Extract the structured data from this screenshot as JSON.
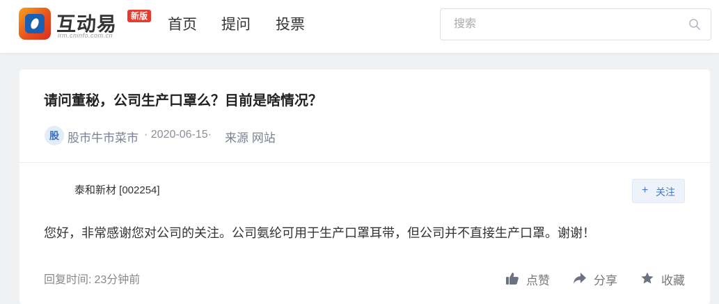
{
  "header": {
    "logo": {
      "name": "互动易",
      "domain": "irm.cninfo.com.cn",
      "badge": "新版"
    },
    "nav": [
      "首页",
      "提问",
      "投票"
    ],
    "search": {
      "placeholder": "搜索",
      "value": ""
    }
  },
  "question": {
    "title": "请问董秘，公司生产口罩么？目前是啥情况？",
    "avatar_char": "股",
    "author": "股市牛市菜市",
    "date": "· 2020-06-15·",
    "source": "来源 网站"
  },
  "answer": {
    "company": "泰和新材 [002254]",
    "follow_label": "关注",
    "text": "您好，非常感谢您对公司的关注。公司氨纶可用于生产口罩耳带，但公司并不直接生产口罩。谢谢！",
    "reply_time_label": "回复时间:",
    "reply_time_value": "23分钟前",
    "actions": {
      "like": "点赞",
      "share": "分享",
      "favorite": "收藏"
    }
  },
  "colors": {
    "accent": "#4a76c2",
    "logo_badge": "#e63b2e",
    "background": "#f0f1f3"
  }
}
